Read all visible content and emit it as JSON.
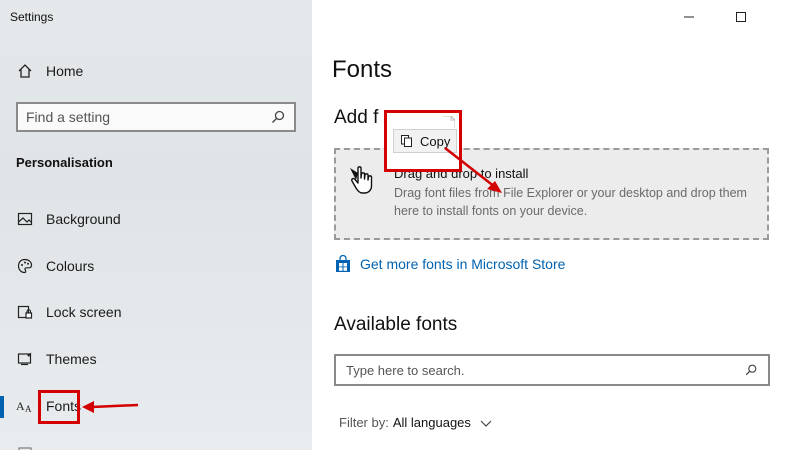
{
  "window": {
    "title": "Settings"
  },
  "sidebar": {
    "home_label": "Home",
    "search_placeholder": "Find a setting",
    "section_heading": "Personalisation",
    "items": [
      {
        "label": "Background",
        "icon": "picture-icon"
      },
      {
        "label": "Colours",
        "icon": "palette-icon"
      },
      {
        "label": "Lock screen",
        "icon": "lock-screen-icon"
      },
      {
        "label": "Themes",
        "icon": "themes-icon"
      },
      {
        "label": "Fonts",
        "icon": "fonts-icon",
        "selected": true
      }
    ]
  },
  "main": {
    "page_title": "Fonts",
    "add_heading": "Add f",
    "drop_zone": {
      "title": "Drag and drop to install",
      "description": "Drag font files from File Explorer or your desktop and drop them here to install fonts on your device."
    },
    "copy_tooltip": "Copy",
    "store_link": "Get more fonts in Microsoft Store",
    "available_heading": "Available fonts",
    "font_search_placeholder": "Type here to search.",
    "filter": {
      "label": "Filter by:",
      "value": "All languages"
    }
  },
  "colors": {
    "accent": "#0063b1",
    "annotation": "#d40000"
  }
}
